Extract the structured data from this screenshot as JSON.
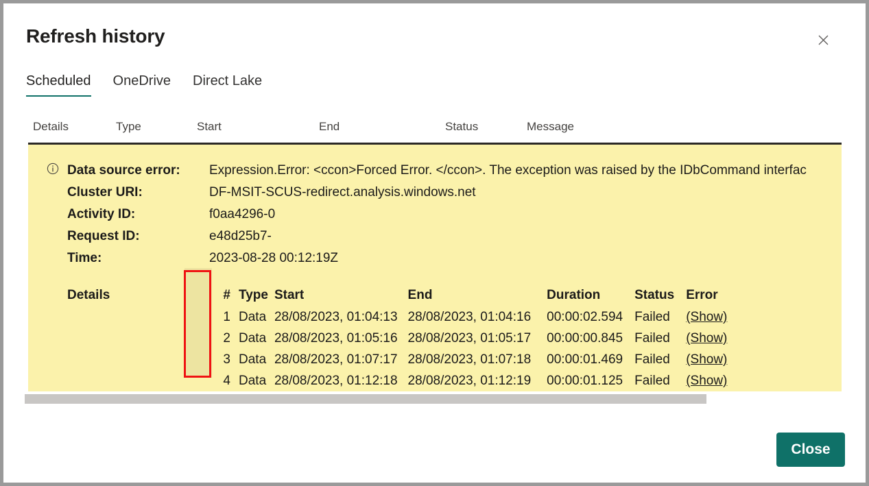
{
  "dialog": {
    "title": "Refresh history",
    "close_icon_label": "close-icon",
    "close_button_label": "Close"
  },
  "tabs": [
    {
      "label": "Scheduled",
      "selected": true
    },
    {
      "label": "OneDrive",
      "selected": false
    },
    {
      "label": "Direct Lake",
      "selected": false
    }
  ],
  "columns": {
    "details": "Details",
    "type": "Type",
    "start": "Start",
    "end": "End",
    "status": "Status",
    "message": "Message"
  },
  "error_panel": {
    "info_icon": "info-icon",
    "fields": [
      {
        "key": "Data source error:",
        "value": "Expression.Error: <ccon>Forced Error. </ccon>. The exception was raised by the IDbCommand interfac"
      },
      {
        "key": "Cluster URI:",
        "value": "DF-MSIT-SCUS-redirect.analysis.windows.net"
      },
      {
        "key": "Activity ID:",
        "value": "f0aa4296-0"
      },
      {
        "key": "Request ID:",
        "value": "e48d25b7-"
      },
      {
        "key": "Time:",
        "value": "2023-08-28 00:12:19Z"
      }
    ],
    "details_label": "Details",
    "details_table": {
      "headers": [
        "#",
        "Type",
        "Start",
        "End",
        "Duration",
        "Status",
        "Error"
      ],
      "rows": [
        {
          "num": "1",
          "type": "Data",
          "start": "28/08/2023, 01:04:13",
          "end": "28/08/2023, 01:04:16",
          "duration": "00:00:02.594",
          "status": "Failed",
          "error": "(Show)"
        },
        {
          "num": "2",
          "type": "Data",
          "start": "28/08/2023, 01:05:16",
          "end": "28/08/2023, 01:05:17",
          "duration": "00:00:00.845",
          "status": "Failed",
          "error": "(Show)"
        },
        {
          "num": "3",
          "type": "Data",
          "start": "28/08/2023, 01:07:17",
          "end": "28/08/2023, 01:07:18",
          "duration": "00:00:01.469",
          "status": "Failed",
          "error": "(Show)"
        },
        {
          "num": "4",
          "type": "Data",
          "start": "28/08/2023, 01:12:18",
          "end": "28/08/2023, 01:12:19",
          "duration": "00:00:01.125",
          "status": "Failed",
          "error": "(Show)"
        }
      ]
    }
  },
  "annotation": {
    "highlight_color": "#ef1212",
    "highlights_column": "#"
  },
  "colors": {
    "accent": "#0f7168",
    "panel_background": "#fbf2ab",
    "scrollbar": "#c8c6c4",
    "window_frame": "#9a9a9a"
  }
}
